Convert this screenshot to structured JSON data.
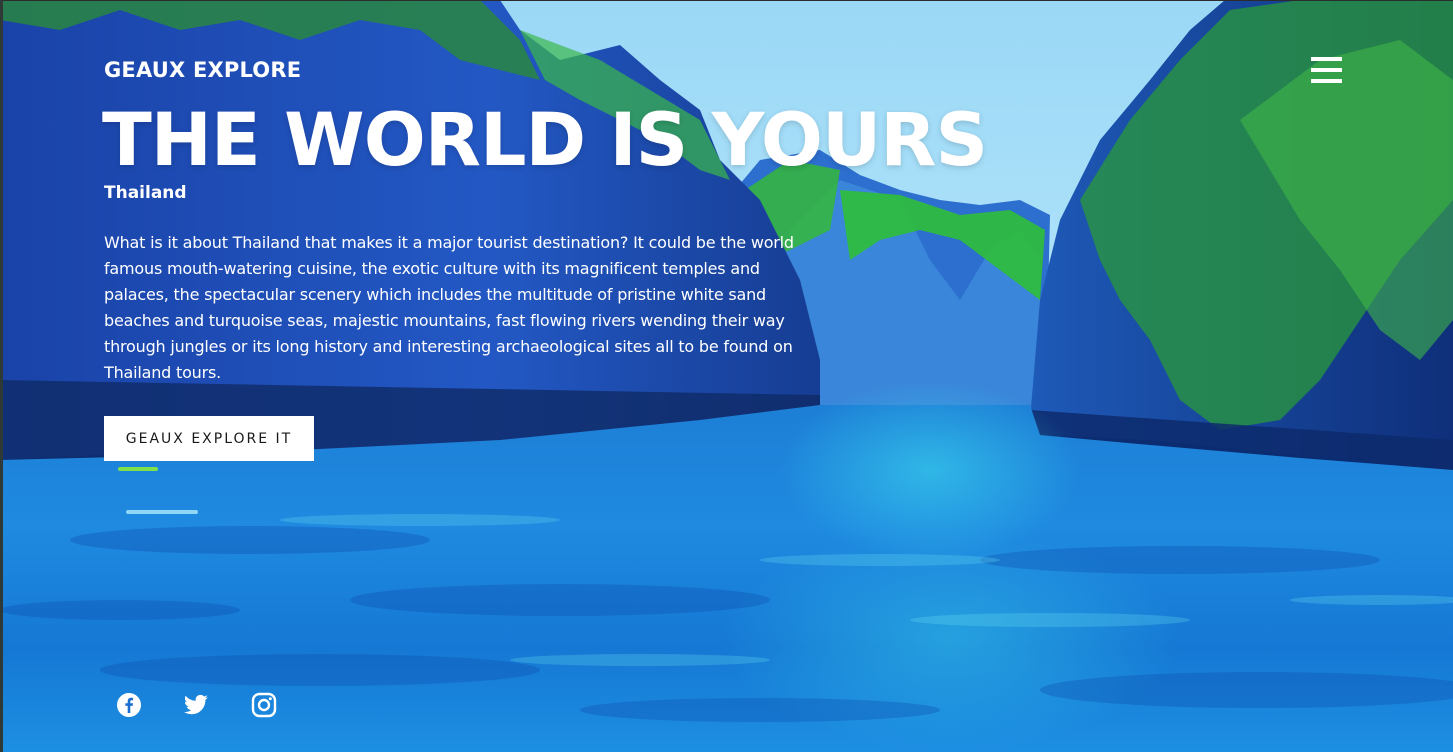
{
  "header": {
    "brand": "GEAUX EXPLORE",
    "menu_icon": "hamburger-menu-icon"
  },
  "hero": {
    "headline": "THE WORLD IS YOURS",
    "location": "Thailand",
    "description": "What is it about Thailand that makes it a major tourist destination? It could be the world famous mouth-watering cuisine, the exotic culture with its magnificent temples and palaces, the spectacular scenery which includes the multitude of pristine white sand beaches and turquoise seas, majestic mountains, fast flowing rivers wending their way through jungles or its long history and interesting archaeological sites all to be found on Thailand tours.",
    "cta_label": "GEAUX EXPLORE IT"
  },
  "social": {
    "icons": [
      "facebook-icon",
      "twitter-icon",
      "instagram-icon"
    ]
  },
  "colors": {
    "text": "#ffffff",
    "button_bg": "#ffffff",
    "button_text": "#1a1a1a",
    "sky": "#9fdcf6",
    "water": "#1a7fd8",
    "cliff": "#1c4fb0",
    "foliage": "#3fbf3a"
  }
}
